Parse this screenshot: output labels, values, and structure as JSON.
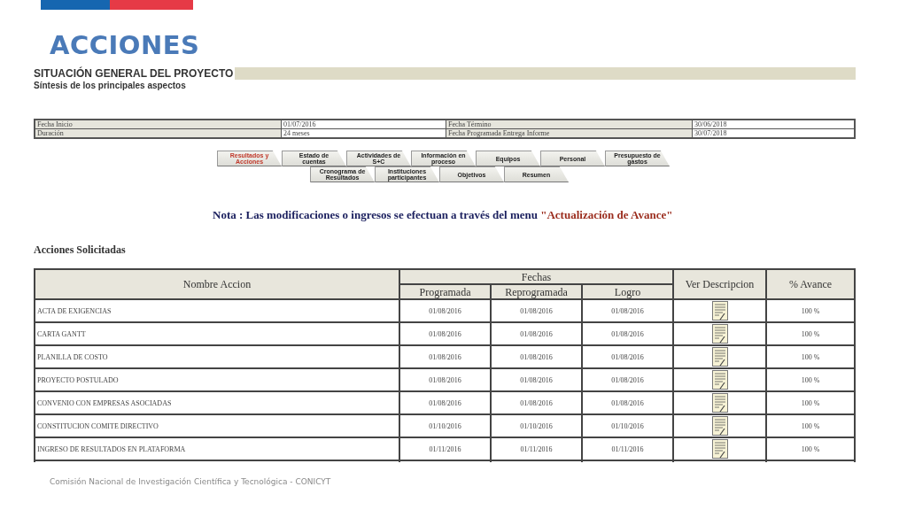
{
  "slide_title": "ACCIONES",
  "section": {
    "title": "SITUACIÓN GENERAL DEL PROYECTO",
    "subtitle": "Síntesis de los principales aspectos"
  },
  "summary": [
    {
      "label": "Fecha Inicio",
      "value": "01/07/2016",
      "label_2": "Fecha Término",
      "value_2": "30/06/2018"
    },
    {
      "label": "Duración",
      "value": "24 meses",
      "label_2": "Fecha Programada Entrega Informe",
      "value_2": "30/07/2018"
    }
  ],
  "tab_rows": [
    [
      {
        "label": "Resultados y Acciones",
        "selected": true
      },
      {
        "label": "Estado de cuentas",
        "selected": false
      },
      {
        "label": "Actividades de S+C",
        "selected": false
      },
      {
        "label": "Información en proceso",
        "selected": false
      },
      {
        "label": "Equipos",
        "selected": false
      },
      {
        "label": "Personal",
        "selected": false
      },
      {
        "label": "Presupuesto de gastos",
        "selected": false
      }
    ],
    [
      {
        "label": "Cronograma de Resultados",
        "selected": false
      },
      {
        "label": "Instituciones participantes",
        "selected": false
      },
      {
        "label": "Objetivos",
        "selected": false
      },
      {
        "label": "Resumen",
        "selected": false
      }
    ]
  ],
  "note": {
    "text": "Nota : Las modificaciones o ingresos se efectuan a través del menu ",
    "link": "\"Actualización de Avance\""
  },
  "table": {
    "title": "Acciones Solicitadas",
    "columns": {
      "name": "Nombre Accion",
      "group": "Fechas",
      "dates": [
        "Programada",
        "Reprogramada",
        "Logro"
      ],
      "view": "Ver Descripcion",
      "progress": "% Avance"
    },
    "rows": [
      {
        "name": "ACTA DE EXIGENCIAS",
        "dates": [
          "01/08/2016",
          "01/08/2016",
          "01/08/2016"
        ],
        "progress": "100 %"
      },
      {
        "name": "CARTA GANTT",
        "dates": [
          "01/08/2016",
          "01/08/2016",
          "01/08/2016"
        ],
        "progress": "100 %"
      },
      {
        "name": "PLANILLA DE COSTO",
        "dates": [
          "01/08/2016",
          "01/08/2016",
          "01/08/2016"
        ],
        "progress": "100 %"
      },
      {
        "name": "PROYECTO POSTULADO",
        "dates": [
          "01/08/2016",
          "01/08/2016",
          "01/08/2016"
        ],
        "progress": "100 %"
      },
      {
        "name": "CONVENIO CON EMPRESAS ASOCIADAS",
        "dates": [
          "01/08/2016",
          "01/08/2016",
          "01/08/2016"
        ],
        "progress": "100 %"
      },
      {
        "name": "CONSTITUCION COMITE DIRECTIVO",
        "dates": [
          "01/10/2016",
          "01/10/2016",
          "01/10/2016"
        ],
        "progress": "100 %"
      },
      {
        "name": "INGRESO DE RESULTADOS EN PLATAFORMA",
        "dates": [
          "01/11/2016",
          "01/11/2016",
          "01/11/2016"
        ],
        "progress": "100 %"
      }
    ]
  },
  "footer": "Comisión Nacional de Investigación Científica y Tecnológica - CONICYT"
}
